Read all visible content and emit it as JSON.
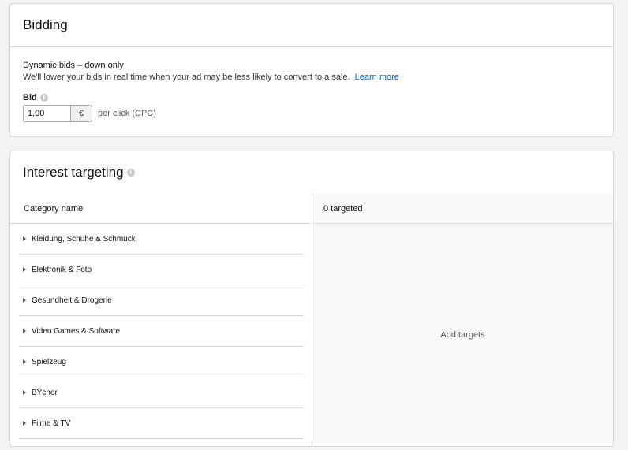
{
  "bidding": {
    "title": "Bidding",
    "strategy_title": "Dynamic bids – down only",
    "strategy_description": "We'll lower your bids in real time when your ad may be less likely to convert to a sale.",
    "learn_more": "Learn more",
    "bid_label": "Bid",
    "bid_value": "1,00",
    "currency": "€",
    "per_click": "per click (CPC)",
    "info_glyph": "i"
  },
  "interest": {
    "title": "Interest targeting",
    "info_glyph": "i",
    "column_category": "Category name",
    "targeted_count": "0 targeted",
    "add_targets": "Add targets",
    "categories": [
      {
        "label": "Kleidung, Schuhe & Schmuck"
      },
      {
        "label": "Elektronik & Foto"
      },
      {
        "label": "Gesundheit & Drogerie"
      },
      {
        "label": "Video Games & Software"
      },
      {
        "label": "Spielzeug"
      },
      {
        "label": "BŸcher"
      },
      {
        "label": "Filme & TV"
      }
    ]
  }
}
